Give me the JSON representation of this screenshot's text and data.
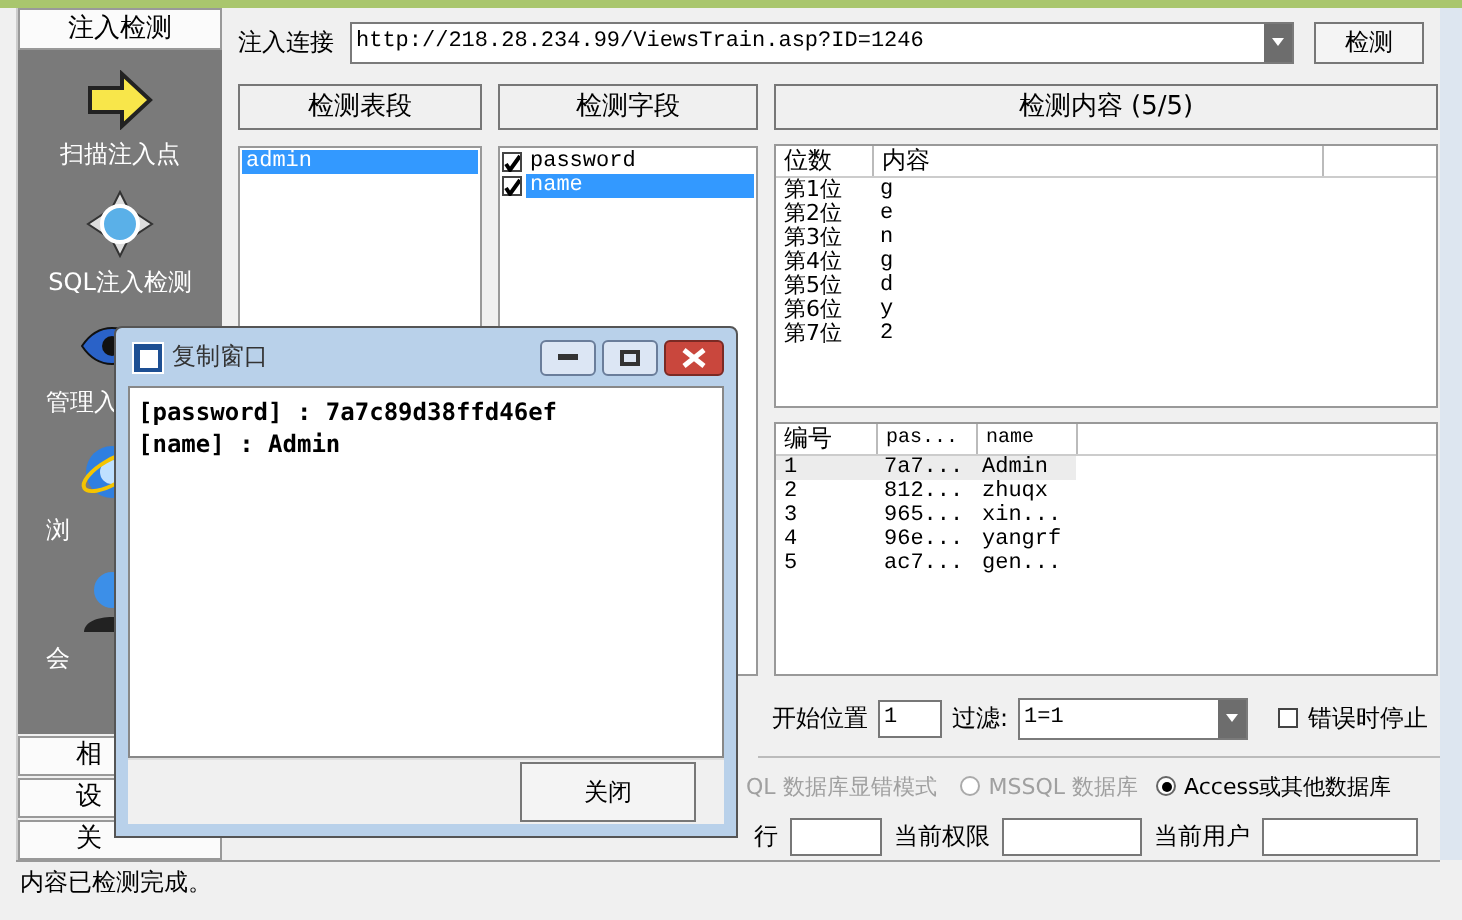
{
  "sidebar": {
    "header": "注入检测",
    "items": [
      {
        "label": "扫描注入点"
      },
      {
        "label": "SQL注入检测"
      },
      {
        "label": "管理入"
      },
      {
        "label": "浏"
      },
      {
        "label": "会"
      }
    ],
    "tabs": [
      "相",
      "设",
      "关"
    ]
  },
  "url_bar": {
    "label": "注入连接",
    "value": "http://218.28.234.99/ViewsTrain.asp?ID=1246",
    "button": "检测"
  },
  "tables_panel": {
    "title": "检测表段",
    "items": [
      {
        "label": "admin",
        "selected": true
      }
    ]
  },
  "fields_panel": {
    "title": "检测字段",
    "items": [
      {
        "label": "password",
        "checked": true,
        "selected": false
      },
      {
        "label": "name",
        "checked": true,
        "selected": true
      }
    ]
  },
  "content_panel": {
    "title": "检测内容 (5/5)",
    "digits_table": {
      "columns": [
        "位数",
        "内容"
      ],
      "rows": [
        [
          "第1位",
          "g"
        ],
        [
          "第2位",
          "e"
        ],
        [
          "第3位",
          "n"
        ],
        [
          "第4位",
          "g"
        ],
        [
          "第5位",
          "d"
        ],
        [
          "第6位",
          "y"
        ],
        [
          "第7位",
          "2"
        ]
      ]
    },
    "records_table": {
      "columns": [
        "编号",
        "pas...",
        "name"
      ],
      "rows": [
        {
          "cells": [
            "1",
            "7a7...",
            "Admin"
          ],
          "selected": true
        },
        {
          "cells": [
            "2",
            "812...",
            "zhuqx"
          ],
          "selected": false
        },
        {
          "cells": [
            "3",
            "965...",
            "xin..."
          ],
          "selected": false
        },
        {
          "cells": [
            "4",
            "96e...",
            "yangrf"
          ],
          "selected": false
        },
        {
          "cells": [
            "5",
            "ac7...",
            "gen..."
          ],
          "selected": false
        }
      ]
    }
  },
  "options": {
    "start_label": "开始位置",
    "start_value": "1",
    "filter_label": "过滤:",
    "filter_value": "1=1",
    "stop_on_error": {
      "label": "错误时停止",
      "checked": false
    }
  },
  "db_modes": [
    {
      "label": "QL 数据库显错模式",
      "disabled": true
    },
    {
      "label": "MSSQL 数据库",
      "selected": false,
      "disabled": true
    },
    {
      "label": "Access或其他数据库",
      "selected": true,
      "disabled": false
    }
  ],
  "info_fields": [
    {
      "label": "行"
    },
    {
      "label": "当前权限"
    },
    {
      "label": "当前用户"
    }
  ],
  "status_bar": "内容已检测完成。",
  "dialog": {
    "title": "复制窗口",
    "lines": [
      "[password] : 7a7c89d38ffd46ef",
      "[name] : Admin"
    ],
    "button": "关闭"
  }
}
